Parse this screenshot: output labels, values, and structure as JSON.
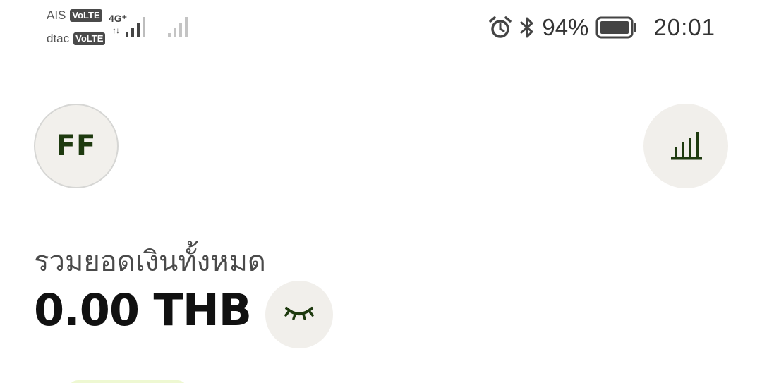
{
  "status_bar": {
    "sim1_carrier": "AIS",
    "sim2_carrier": "dtac",
    "volte_badge": "VoLTE",
    "network_type": "4G⁺",
    "data_arrows": "↑↓",
    "battery_percent": "94%",
    "time": "20:01",
    "icons": [
      "alarm-icon",
      "bluetooth-icon",
      "battery-icon",
      "signal-icon"
    ]
  },
  "header": {
    "avatar_initials": "FF",
    "stats_icon": "bar-chart-icon"
  },
  "balance": {
    "label": "รวมยอดเงินทั้งหมด",
    "amount": "0.00 THB",
    "visibility_icon": "eye-closed-icon"
  },
  "colors": {
    "accent_dark_green": "#1e3a0f",
    "circle_bg": "#f1efeb",
    "peek_bg": "#eef8d2"
  }
}
